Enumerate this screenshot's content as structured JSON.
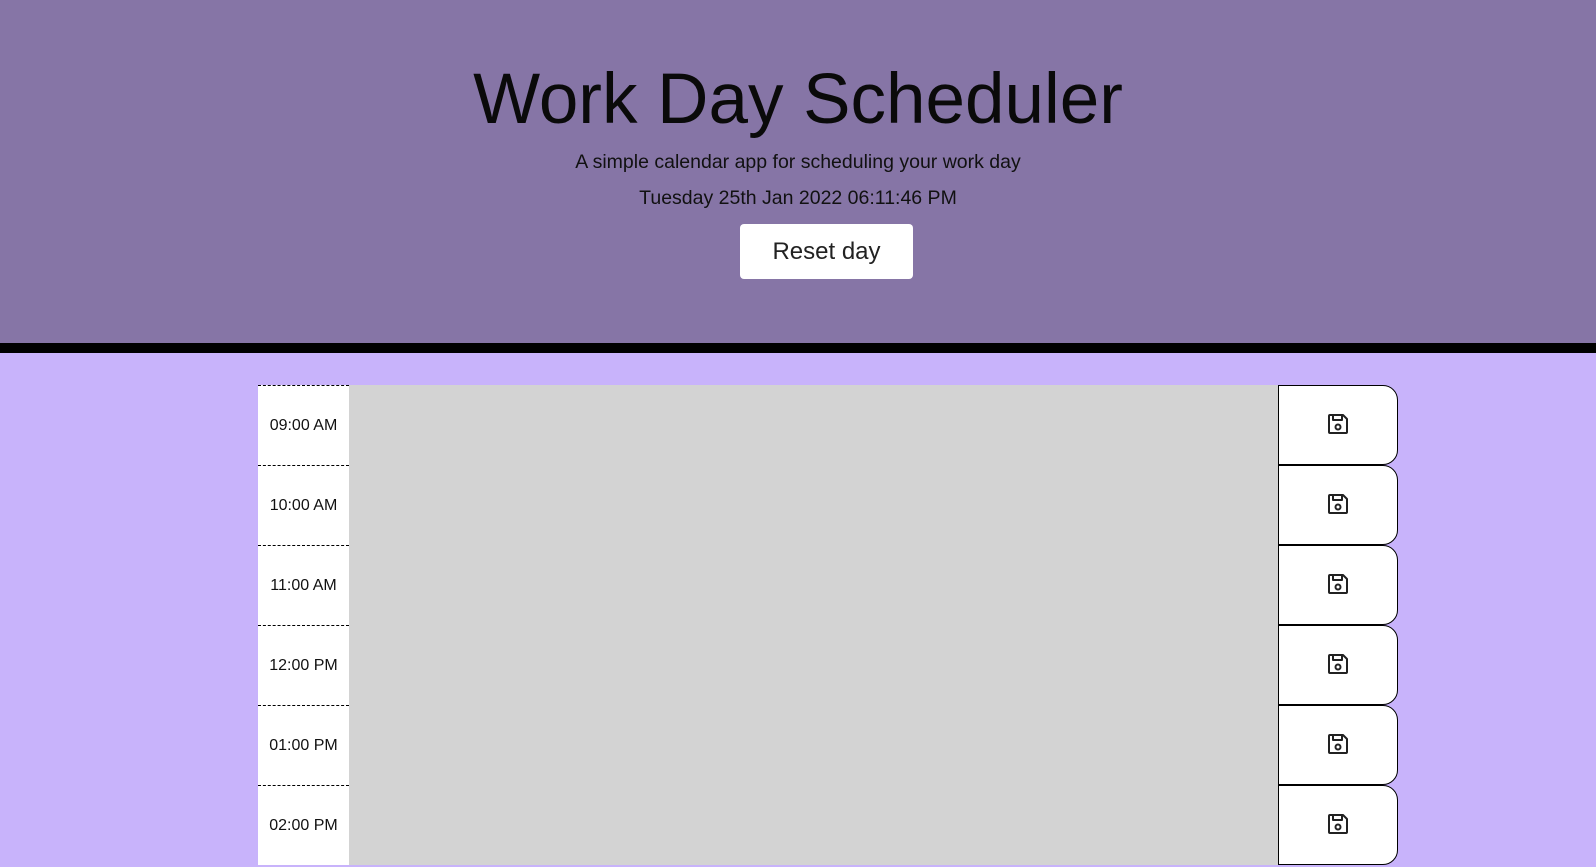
{
  "header": {
    "title": "Work Day Scheduler",
    "lead": "A simple calendar app for scheduling your work day",
    "current_day": "Tuesday 25th Jan 2022 06:11:46 PM",
    "reset_label": "Reset day"
  },
  "schedule": {
    "rows": [
      {
        "hour": "09:00 AM",
        "text": ""
      },
      {
        "hour": "10:00 AM",
        "text": ""
      },
      {
        "hour": "11:00 AM",
        "text": ""
      },
      {
        "hour": "12:00 PM",
        "text": ""
      },
      {
        "hour": "01:00 PM",
        "text": ""
      },
      {
        "hour": "02:00 PM",
        "text": ""
      }
    ],
    "save_icon": "save-icon"
  },
  "colors": {
    "header_bg": "#8675a6",
    "page_bg": "#c8b3fb",
    "past_block": "#d3d3d3"
  }
}
